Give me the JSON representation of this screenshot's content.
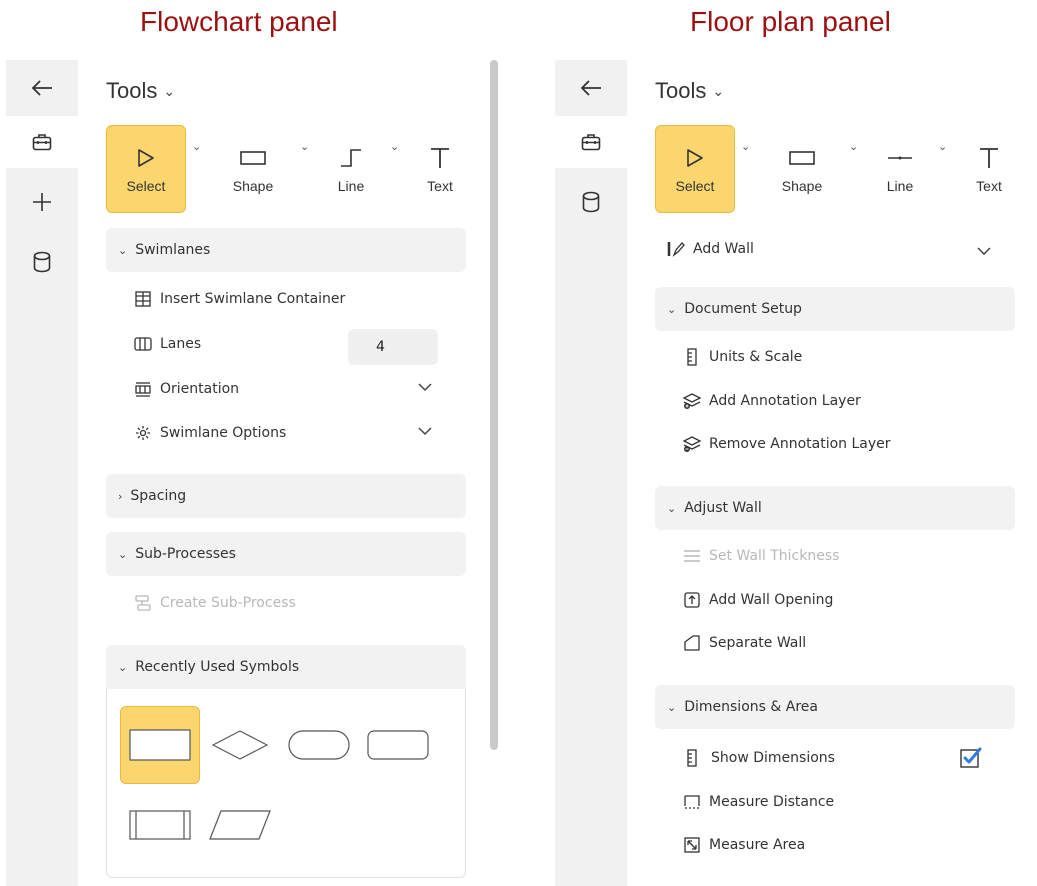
{
  "headings": {
    "left": "Flowchart panel",
    "right": "Floor plan panel"
  },
  "flowchart": {
    "tools_title": "Tools",
    "tools": [
      {
        "label": "Select",
        "icon": "pointer-icon",
        "active": true
      },
      {
        "label": "Shape",
        "icon": "rectangle-icon"
      },
      {
        "label": "Line",
        "icon": "elbow-line-icon"
      },
      {
        "label": "Text",
        "icon": "text-icon"
      }
    ],
    "swimlanes": {
      "title": "Swimlanes",
      "insert": "Insert Swimlane Container",
      "lanes": "Lanes",
      "lanes_value": "4",
      "orientation": "Orientation",
      "options": "Swimlane Options"
    },
    "spacing": {
      "title": "Spacing"
    },
    "subprocesses": {
      "title": "Sub-Processes",
      "create": "Create Sub-Process"
    },
    "recent": {
      "title": "Recently Used Symbols"
    }
  },
  "floorplan": {
    "tools_title": "Tools",
    "tools": [
      {
        "label": "Select",
        "icon": "pointer-icon",
        "active": true
      },
      {
        "label": "Shape",
        "icon": "rectangle-icon"
      },
      {
        "label": "Line",
        "icon": "line-icon"
      },
      {
        "label": "Text",
        "icon": "text-icon"
      }
    ],
    "add_wall": "Add Wall",
    "document_setup": {
      "title": "Document Setup",
      "units": "Units & Scale",
      "add_layer": "Add Annotation Layer",
      "remove_layer": "Remove Annotation Layer"
    },
    "adjust_wall": {
      "title": "Adjust Wall",
      "thickness": "Set Wall Thickness",
      "opening": "Add Wall Opening",
      "separate": "Separate Wall"
    },
    "dimensions": {
      "title": "Dimensions & Area",
      "show": "Show Dimensions",
      "show_checked": true,
      "measure_distance": "Measure Distance",
      "measure_area": "Measure Area"
    }
  }
}
